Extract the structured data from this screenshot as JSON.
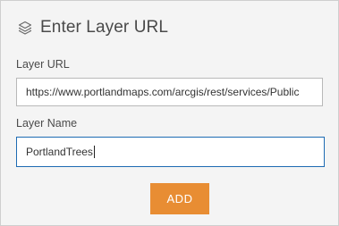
{
  "header": {
    "icon": "layers-icon",
    "title": "Enter Layer URL"
  },
  "form": {
    "url_label": "Layer URL",
    "url_value": "https://www.portlandmaps.com/arcgis/rest/services/Public",
    "name_label": "Layer Name",
    "name_value": "PortlandTrees",
    "add_label": "ADD"
  },
  "colors": {
    "button": "#e88d33",
    "focus_border": "#1e6bb3",
    "panel_background": "#f4f4f4"
  }
}
